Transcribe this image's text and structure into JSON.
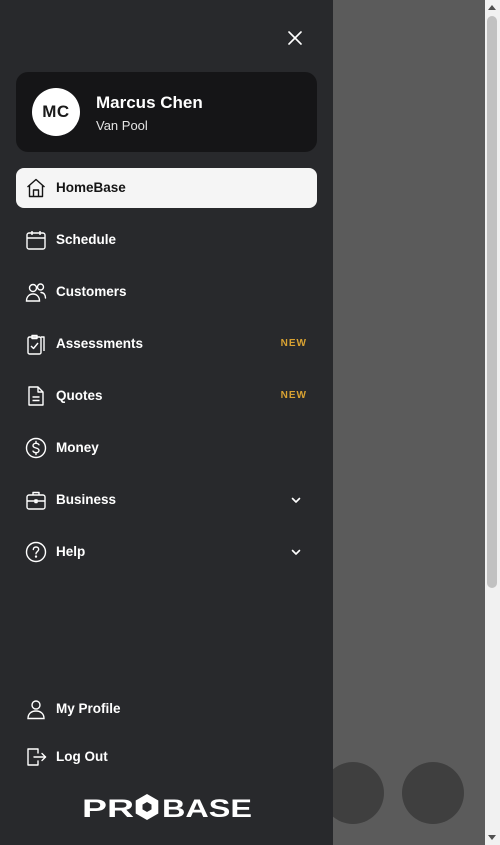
{
  "profile": {
    "initials": "MC",
    "name": "Marcus Chen",
    "organization": "Van Pool"
  },
  "nav": [
    {
      "label": "HomeBase",
      "icon": "home-icon",
      "active": true
    },
    {
      "label": "Schedule",
      "icon": "calendar-icon"
    },
    {
      "label": "Customers",
      "icon": "users-icon"
    },
    {
      "label": "Assessments",
      "icon": "clipboard-check-icon",
      "badge": "NEW"
    },
    {
      "label": "Quotes",
      "icon": "document-icon",
      "badge": "NEW"
    },
    {
      "label": "Money",
      "icon": "dollar-icon"
    },
    {
      "label": "Business",
      "icon": "briefcase-icon",
      "expandable": true
    },
    {
      "label": "Help",
      "icon": "help-icon",
      "expandable": true
    }
  ],
  "footer": {
    "profile_label": "My Profile",
    "logout_label": "Log Out",
    "logo_text": "PROBASE"
  },
  "colors": {
    "drawer_bg": "#28292c",
    "card_bg": "#151517",
    "active_bg": "#f5f5f5",
    "badge": "#d9a232"
  }
}
